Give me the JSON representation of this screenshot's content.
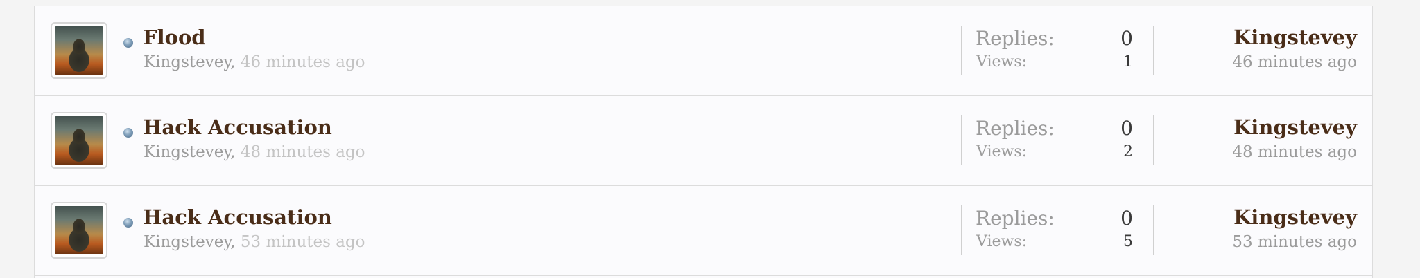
{
  "threads": [
    {
      "title": "Flood",
      "author": "Kingstevey",
      "separator": ", ",
      "time": "46 minutes ago",
      "replies_label": "Replies:",
      "replies": "0",
      "views_label": "Views:",
      "views": "1",
      "last_poster": "Kingstevey",
      "last_time": "46 minutes ago"
    },
    {
      "title": "Hack Accusation",
      "author": "Kingstevey",
      "separator": ", ",
      "time": "48 minutes ago",
      "replies_label": "Replies:",
      "replies": "0",
      "views_label": "Views:",
      "views": "2",
      "last_poster": "Kingstevey",
      "last_time": "48 minutes ago"
    },
    {
      "title": "Hack Accusation",
      "author": "Kingstevey",
      "separator": ", ",
      "time": "53 minutes ago",
      "replies_label": "Replies:",
      "replies": "0",
      "views_label": "Views:",
      "views": "5",
      "last_poster": "Kingstevey",
      "last_time": "53 minutes ago"
    }
  ]
}
